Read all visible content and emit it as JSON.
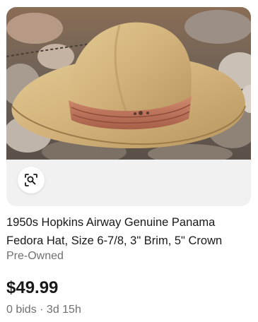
{
  "listing": {
    "image_alt": "Tan straw Panama fedora hat with a rust-colored pleated band resting on rocks",
    "visual_search_icon": "visual-search-icon",
    "title": "1950s Hopkins Airway Genuine Panama Fedora Hat, Size 6-7/8, 3\" Brim, 5\" Crown",
    "condition": "Pre-Owned",
    "price": "$49.99",
    "bids_time": "0 bids · 3d 15h"
  },
  "colors": {
    "price_text": "#191919",
    "secondary_text": "#707070",
    "image_bg": "#f1f1f1"
  }
}
